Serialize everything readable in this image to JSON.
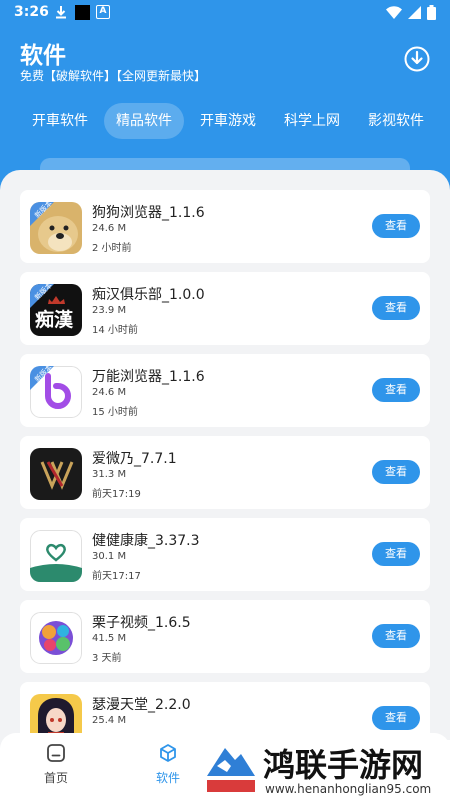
{
  "status": {
    "time": "3:26",
    "a_icon": "A"
  },
  "header": {
    "title": "软件",
    "subtitle": "免费【破解软件】【全网更新最快】"
  },
  "tabs": [
    {
      "label": "开車软件",
      "active": false
    },
    {
      "label": "精品软件",
      "active": true
    },
    {
      "label": "开車游戏",
      "active": false
    },
    {
      "label": "科学上网",
      "active": false
    },
    {
      "label": "影视软件",
      "active": false
    }
  ],
  "apps": [
    {
      "name": "狗狗浏览器_1.1.6",
      "size": "24.6 M",
      "time": "2 小时前",
      "button": "查看",
      "badge": "新版本"
    },
    {
      "name": "痴汉俱乐部_1.0.0",
      "size": "23.9 M",
      "time": "14 小时前",
      "button": "查看",
      "badge": "新版本",
      "icon_text": "痴漢"
    },
    {
      "name": "万能浏览器_1.1.6",
      "size": "24.6 M",
      "time": "15 小时前",
      "button": "查看",
      "badge": "新版本"
    },
    {
      "name": "爱微乃_7.7.1",
      "size": "31.3 M",
      "time": "前天17:19",
      "button": "查看"
    },
    {
      "name": "健健康康_3.37.3",
      "size": "30.1 M",
      "time": "前天17:17",
      "button": "查看"
    },
    {
      "name": "栗子视频_1.6.5",
      "size": "41.5 M",
      "time": "3 天前",
      "button": "查看"
    },
    {
      "name": "瑟漫天堂_2.2.0",
      "size": "25.4 M",
      "time": "",
      "button": "查看"
    }
  ],
  "nav": {
    "home": "首页",
    "software": "软件"
  },
  "watermark": {
    "title": "鸿联手游网",
    "url": "www.henanhonglian95.com"
  },
  "colors": {
    "accent": "#2f95ea",
    "background": "#f2f3f5"
  }
}
